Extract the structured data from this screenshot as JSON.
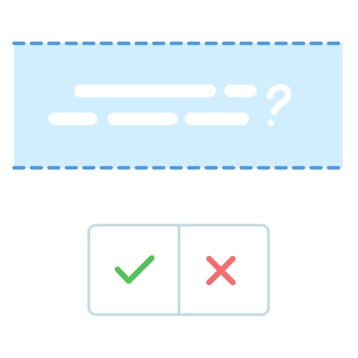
{
  "question_panel": {
    "icon": "question-mark-icon",
    "fill_color": "#d1eefe",
    "border_color": "#4a9ae2",
    "text_line_color": "#ffffff"
  },
  "answer_buttons": {
    "border_color": "#c5dce6",
    "background": "#ffffff",
    "confirm": {
      "icon": "checkmark-icon",
      "color": "#52c358"
    },
    "reject": {
      "icon": "cross-icon",
      "color": "#f76a6d"
    }
  }
}
